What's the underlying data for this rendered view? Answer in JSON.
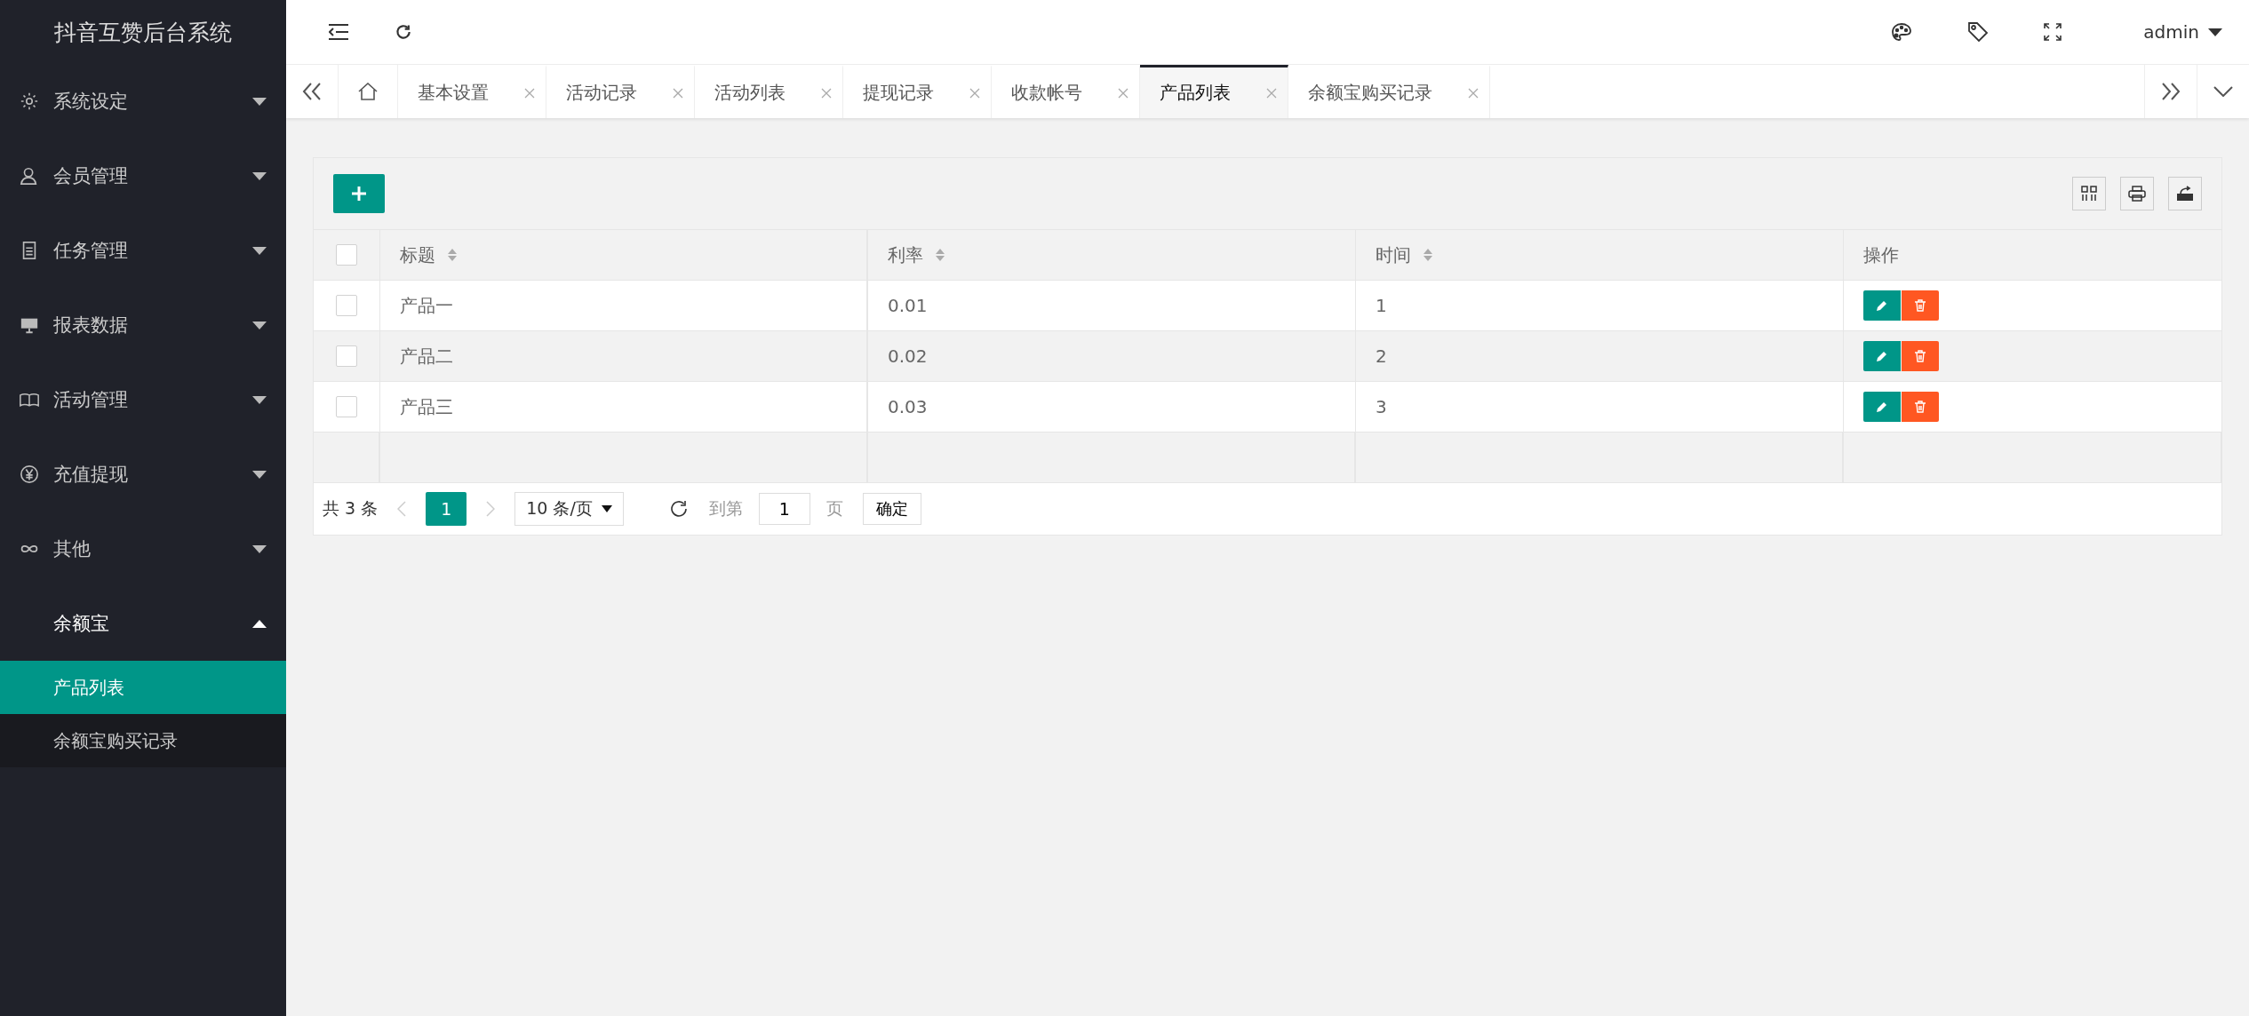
{
  "app_title": "抖音互赞后台系统",
  "sidebar": {
    "items": [
      {
        "label": "系统设定",
        "expanded": false
      },
      {
        "label": "会员管理",
        "expanded": false
      },
      {
        "label": "任务管理",
        "expanded": false
      },
      {
        "label": "报表数据",
        "expanded": false
      },
      {
        "label": "活动管理",
        "expanded": false
      },
      {
        "label": "充值提现",
        "expanded": false
      },
      {
        "label": "其他",
        "expanded": false
      },
      {
        "label": "余额宝",
        "expanded": true,
        "children": [
          {
            "label": "产品列表",
            "selected": true
          },
          {
            "label": "余额宝购买记录",
            "selected": false
          }
        ]
      }
    ]
  },
  "user": "admin",
  "tabs": [
    {
      "label": "基本设置",
      "selected": false
    },
    {
      "label": "活动记录",
      "selected": false
    },
    {
      "label": "活动列表",
      "selected": false
    },
    {
      "label": "提现记录",
      "selected": false
    },
    {
      "label": "收款帐号",
      "selected": false
    },
    {
      "label": "产品列表",
      "selected": true
    },
    {
      "label": "余额宝购买记录",
      "selected": false
    }
  ],
  "table": {
    "select_all_checked": false,
    "columns": [
      "标题",
      "利率",
      "时间",
      "操作"
    ],
    "rows": [
      {
        "checked": false,
        "cells": [
          "产品一",
          "0.01",
          "1"
        ]
      },
      {
        "checked": false,
        "cells": [
          "产品二",
          "0.02",
          "2"
        ]
      },
      {
        "checked": false,
        "cells": [
          "产品三",
          "0.03",
          "3"
        ]
      }
    ]
  },
  "pagination": {
    "total": "共 3 条",
    "pages": [
      {
        "label": "1",
        "selected": true
      }
    ],
    "page_size": "10 条/页",
    "goto_label": "到第",
    "goto_value": "1",
    "page_unit": "页",
    "confirm": "确定"
  }
}
